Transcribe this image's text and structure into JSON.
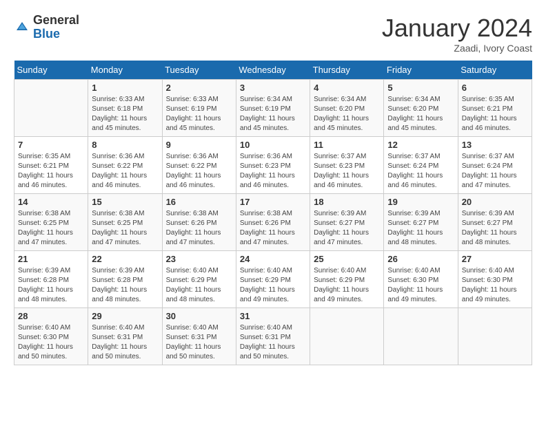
{
  "header": {
    "logo_general": "General",
    "logo_blue": "Blue",
    "title": "January 2024",
    "subtitle": "Zaadi, Ivory Coast"
  },
  "weekdays": [
    "Sunday",
    "Monday",
    "Tuesday",
    "Wednesday",
    "Thursday",
    "Friday",
    "Saturday"
  ],
  "weeks": [
    [
      {
        "day": "",
        "info": ""
      },
      {
        "day": "1",
        "info": "Sunrise: 6:33 AM\nSunset: 6:18 PM\nDaylight: 11 hours\nand 45 minutes."
      },
      {
        "day": "2",
        "info": "Sunrise: 6:33 AM\nSunset: 6:19 PM\nDaylight: 11 hours\nand 45 minutes."
      },
      {
        "day": "3",
        "info": "Sunrise: 6:34 AM\nSunset: 6:19 PM\nDaylight: 11 hours\nand 45 minutes."
      },
      {
        "day": "4",
        "info": "Sunrise: 6:34 AM\nSunset: 6:20 PM\nDaylight: 11 hours\nand 45 minutes."
      },
      {
        "day": "5",
        "info": "Sunrise: 6:34 AM\nSunset: 6:20 PM\nDaylight: 11 hours\nand 45 minutes."
      },
      {
        "day": "6",
        "info": "Sunrise: 6:35 AM\nSunset: 6:21 PM\nDaylight: 11 hours\nand 46 minutes."
      }
    ],
    [
      {
        "day": "7",
        "info": "Sunrise: 6:35 AM\nSunset: 6:21 PM\nDaylight: 11 hours\nand 46 minutes."
      },
      {
        "day": "8",
        "info": "Sunrise: 6:36 AM\nSunset: 6:22 PM\nDaylight: 11 hours\nand 46 minutes."
      },
      {
        "day": "9",
        "info": "Sunrise: 6:36 AM\nSunset: 6:22 PM\nDaylight: 11 hours\nand 46 minutes."
      },
      {
        "day": "10",
        "info": "Sunrise: 6:36 AM\nSunset: 6:23 PM\nDaylight: 11 hours\nand 46 minutes."
      },
      {
        "day": "11",
        "info": "Sunrise: 6:37 AM\nSunset: 6:23 PM\nDaylight: 11 hours\nand 46 minutes."
      },
      {
        "day": "12",
        "info": "Sunrise: 6:37 AM\nSunset: 6:24 PM\nDaylight: 11 hours\nand 46 minutes."
      },
      {
        "day": "13",
        "info": "Sunrise: 6:37 AM\nSunset: 6:24 PM\nDaylight: 11 hours\nand 47 minutes."
      }
    ],
    [
      {
        "day": "14",
        "info": "Sunrise: 6:38 AM\nSunset: 6:25 PM\nDaylight: 11 hours\nand 47 minutes."
      },
      {
        "day": "15",
        "info": "Sunrise: 6:38 AM\nSunset: 6:25 PM\nDaylight: 11 hours\nand 47 minutes."
      },
      {
        "day": "16",
        "info": "Sunrise: 6:38 AM\nSunset: 6:26 PM\nDaylight: 11 hours\nand 47 minutes."
      },
      {
        "day": "17",
        "info": "Sunrise: 6:38 AM\nSunset: 6:26 PM\nDaylight: 11 hours\nand 47 minutes."
      },
      {
        "day": "18",
        "info": "Sunrise: 6:39 AM\nSunset: 6:27 PM\nDaylight: 11 hours\nand 47 minutes."
      },
      {
        "day": "19",
        "info": "Sunrise: 6:39 AM\nSunset: 6:27 PM\nDaylight: 11 hours\nand 48 minutes."
      },
      {
        "day": "20",
        "info": "Sunrise: 6:39 AM\nSunset: 6:27 PM\nDaylight: 11 hours\nand 48 minutes."
      }
    ],
    [
      {
        "day": "21",
        "info": "Sunrise: 6:39 AM\nSunset: 6:28 PM\nDaylight: 11 hours\nand 48 minutes."
      },
      {
        "day": "22",
        "info": "Sunrise: 6:39 AM\nSunset: 6:28 PM\nDaylight: 11 hours\nand 48 minutes."
      },
      {
        "day": "23",
        "info": "Sunrise: 6:40 AM\nSunset: 6:29 PM\nDaylight: 11 hours\nand 48 minutes."
      },
      {
        "day": "24",
        "info": "Sunrise: 6:40 AM\nSunset: 6:29 PM\nDaylight: 11 hours\nand 49 minutes."
      },
      {
        "day": "25",
        "info": "Sunrise: 6:40 AM\nSunset: 6:29 PM\nDaylight: 11 hours\nand 49 minutes."
      },
      {
        "day": "26",
        "info": "Sunrise: 6:40 AM\nSunset: 6:30 PM\nDaylight: 11 hours\nand 49 minutes."
      },
      {
        "day": "27",
        "info": "Sunrise: 6:40 AM\nSunset: 6:30 PM\nDaylight: 11 hours\nand 49 minutes."
      }
    ],
    [
      {
        "day": "28",
        "info": "Sunrise: 6:40 AM\nSunset: 6:30 PM\nDaylight: 11 hours\nand 50 minutes."
      },
      {
        "day": "29",
        "info": "Sunrise: 6:40 AM\nSunset: 6:31 PM\nDaylight: 11 hours\nand 50 minutes."
      },
      {
        "day": "30",
        "info": "Sunrise: 6:40 AM\nSunset: 6:31 PM\nDaylight: 11 hours\nand 50 minutes."
      },
      {
        "day": "31",
        "info": "Sunrise: 6:40 AM\nSunset: 6:31 PM\nDaylight: 11 hours\nand 50 minutes."
      },
      {
        "day": "",
        "info": ""
      },
      {
        "day": "",
        "info": ""
      },
      {
        "day": "",
        "info": ""
      }
    ]
  ]
}
